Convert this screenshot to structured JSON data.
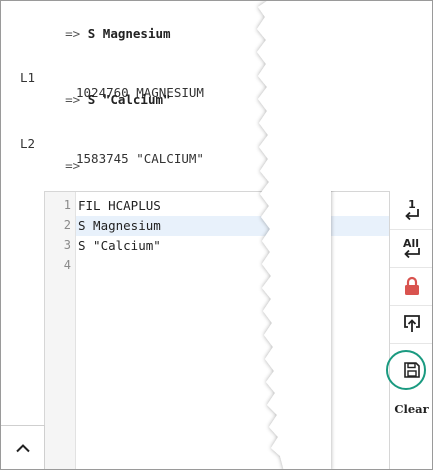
{
  "terminal": {
    "line1": {
      "prompt": "=>",
      "command": "S Magnesium"
    },
    "line2": {
      "label": "L1",
      "result": "1024760 MAGNESIUM"
    },
    "line3": {
      "prompt": "=>",
      "command": "S \"Calcium\""
    },
    "line4": {
      "label": "L2",
      "result": "1583745 \"CALCIUM\""
    },
    "line5": {
      "prompt": "=>"
    }
  },
  "editor": {
    "lines": [
      {
        "num": "1",
        "text": "FIL HCAPLUS"
      },
      {
        "num": "2",
        "text": "S Magnesium"
      },
      {
        "num": "3",
        "text": "S \"Calcium\""
      },
      {
        "num": "4",
        "text": ""
      }
    ]
  },
  "toolbar": {
    "clear_label": "Clear",
    "icons": [
      "run-line-icon",
      "run-all-icon",
      "lock-icon",
      "upload-icon",
      "save-icon"
    ],
    "lock_color": "#d9534f",
    "highlight_color": "#1a9a80"
  }
}
